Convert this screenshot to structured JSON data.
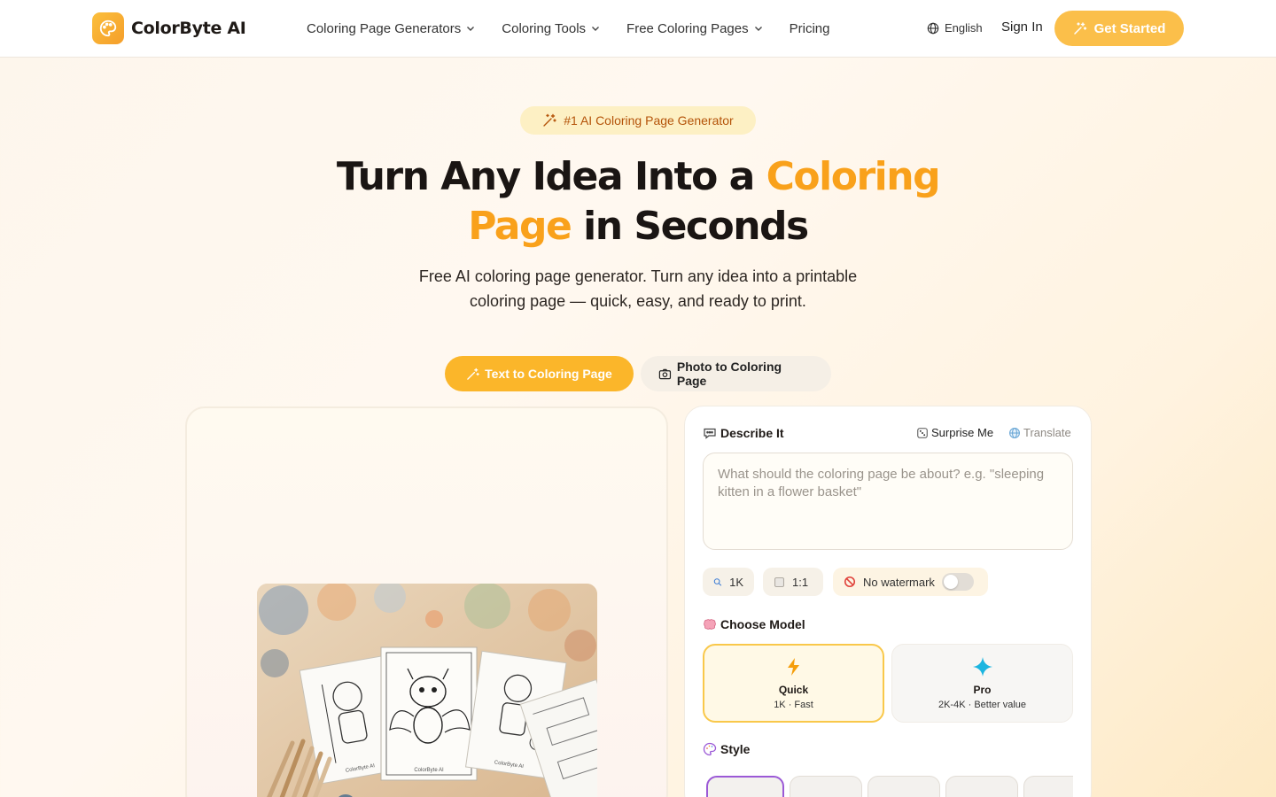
{
  "header": {
    "brand": "ColorByte AI",
    "nav": [
      {
        "label": "Coloring Page Generators",
        "dropdown": true
      },
      {
        "label": "Coloring Tools",
        "dropdown": true
      },
      {
        "label": "Free Coloring Pages",
        "dropdown": true
      },
      {
        "label": "Pricing",
        "dropdown": false
      }
    ],
    "language": "English",
    "sign_in": "Sign In",
    "get_started": "Get Started"
  },
  "hero": {
    "badge": "#1 AI Coloring Page Generator",
    "title_part1": "Turn Any Idea Into a ",
    "title_highlight": "Coloring Page",
    "title_part2": " in Seconds",
    "subtitle_line1": "Free AI coloring page generator. Turn any idea into a printable",
    "subtitle_line2": "coloring page — quick, easy, and ready to print."
  },
  "mode_tabs": [
    {
      "label": "Text to Coloring Page",
      "active": true
    },
    {
      "label": "Photo to Coloring Page",
      "active": false
    }
  ],
  "preview": {
    "sheet_labels": [
      "ColorByte AI",
      "ColorByte AI",
      "ColorByte AI"
    ]
  },
  "panel": {
    "describe_label": "Describe It",
    "surprise_me": "Surprise Me",
    "translate": "Translate",
    "prompt_placeholder": "What should the coloring page be about? e.g. \"sleeping kitten in a flower basket\"",
    "chips": {
      "resolution": "1K",
      "aspect_ratio": "1:1",
      "watermark": "No watermark"
    },
    "watermark_toggle_on": false,
    "choose_model_label": "Choose Model",
    "models": [
      {
        "name": "Quick",
        "desc": "1K · Fast",
        "selected": true
      },
      {
        "name": "Pro",
        "desc": "2K-4K · Better value",
        "selected": false
      }
    ],
    "style_label": "Style"
  },
  "colors": {
    "accent": "#f9a11b",
    "cta": "#fbbf4a",
    "badge_bg": "#fdf0c4",
    "badge_text": "#b45309",
    "selected_style_border": "#9b59d6",
    "pro_icon": "#1bb5e0"
  }
}
